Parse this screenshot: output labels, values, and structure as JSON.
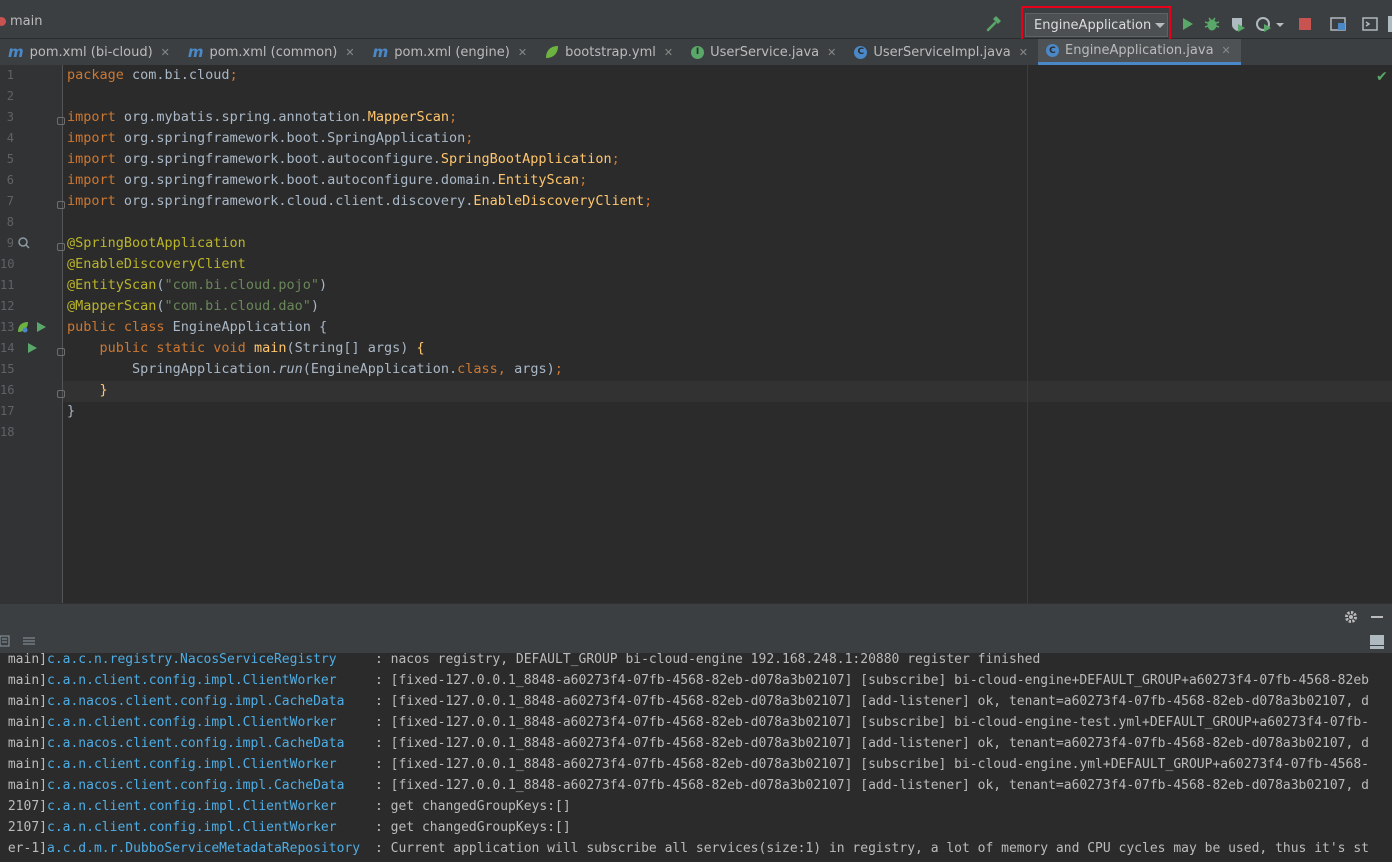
{
  "toolbar": {
    "branch": "main",
    "run_config": "EngineApplication"
  },
  "tabs": [
    {
      "label": "pom.xml (bi-cloud)",
      "icon": "maven-icon",
      "active": false
    },
    {
      "label": "pom.xml (common)",
      "icon": "maven-icon",
      "active": false
    },
    {
      "label": "pom.xml (engine)",
      "icon": "maven-icon",
      "active": false
    },
    {
      "label": "bootstrap.yml",
      "icon": "spring-leaf-icon",
      "active": false
    },
    {
      "label": "UserService.java",
      "icon": "interface-icon",
      "active": false
    },
    {
      "label": "UserServiceImpl.java",
      "icon": "class-icon",
      "active": false
    },
    {
      "label": "EngineApplication.java",
      "icon": "spring-class-icon",
      "active": true
    }
  ],
  "editor": {
    "line_numbers": [
      "1",
      "2",
      "3",
      "4",
      "5",
      "6",
      "7",
      "8",
      "9",
      "10",
      "11",
      "12",
      "13",
      "14",
      "15",
      "16",
      "17",
      "18"
    ],
    "lines": [
      [
        [
          "kw",
          "package "
        ],
        [
          "pl",
          "com.bi.cloud"
        ],
        [
          "kw",
          ";"
        ]
      ],
      [],
      [
        [
          "kw",
          "import "
        ],
        [
          "pl",
          "org.mybatis.spring.annotation."
        ],
        [
          "fn",
          "MapperScan"
        ],
        [
          "kw",
          ";"
        ]
      ],
      [
        [
          "kw",
          "import "
        ],
        [
          "pl",
          "org.springframework.boot.SpringApplication"
        ],
        [
          "kw",
          ";"
        ]
      ],
      [
        [
          "kw",
          "import "
        ],
        [
          "pl",
          "org.springframework.boot.autoconfigure."
        ],
        [
          "fn",
          "SpringBootApplication"
        ],
        [
          "kw",
          ";"
        ]
      ],
      [
        [
          "kw",
          "import "
        ],
        [
          "pl",
          "org.springframework.boot.autoconfigure.domain."
        ],
        [
          "fn",
          "EntityScan"
        ],
        [
          "kw",
          ";"
        ]
      ],
      [
        [
          "kw",
          "import "
        ],
        [
          "pl",
          "org.springframework.cloud.client.discovery."
        ],
        [
          "fn",
          "EnableDiscoveryClient"
        ],
        [
          "kw",
          ";"
        ]
      ],
      [],
      [
        [
          "ann",
          "@SpringBootApplication"
        ]
      ],
      [
        [
          "ann",
          "@EnableDiscoveryClient"
        ]
      ],
      [
        [
          "ann",
          "@EntityScan"
        ],
        [
          "pl",
          "("
        ],
        [
          "str",
          "\"com.bi.cloud.pojo\""
        ],
        [
          "pl",
          ")"
        ]
      ],
      [
        [
          "ann",
          "@MapperScan"
        ],
        [
          "pl",
          "("
        ],
        [
          "str",
          "\"com.bi.cloud.dao\""
        ],
        [
          "pl",
          ")"
        ]
      ],
      [
        [
          "kw",
          "public class "
        ],
        [
          "pl",
          "EngineApplication {"
        ]
      ],
      [
        [
          "pl",
          "    "
        ],
        [
          "kw",
          "public static void "
        ],
        [
          "fn",
          "main"
        ],
        [
          "pl",
          "(String[] args) "
        ],
        [
          "fn",
          "{"
        ]
      ],
      [
        [
          "pl",
          "        SpringApplication."
        ],
        [
          "it",
          "run"
        ],
        [
          "pl",
          "(EngineApplication."
        ],
        [
          "kw",
          "class"
        ],
        [
          "kw",
          ", "
        ],
        [
          "pl",
          "args)"
        ],
        [
          "kw",
          ";"
        ]
      ],
      [
        [
          "pl",
          "    "
        ],
        [
          "fn",
          "}"
        ]
      ],
      [
        [
          "pl",
          "}"
        ]
      ],
      []
    ]
  },
  "console": {
    "lines": [
      {
        "thread": "main]",
        "logger": "c.a.c.n.registry.NacosServiceRegistry",
        "message": ": nacos registry, DEFAULT_GROUP bi-cloud-engine 192.168.248.1:20880 register finished"
      },
      {
        "thread": "main]",
        "logger": "c.a.n.client.config.impl.ClientWorker",
        "message": ": [fixed-127.0.0.1_8848-a60273f4-07fb-4568-82eb-d078a3b02107] [subscribe] bi-cloud-engine+DEFAULT_GROUP+a60273f4-07fb-4568-82eb"
      },
      {
        "thread": "main]",
        "logger": "c.a.nacos.client.config.impl.CacheData",
        "message": ": [fixed-127.0.0.1_8848-a60273f4-07fb-4568-82eb-d078a3b02107] [add-listener] ok, tenant=a60273f4-07fb-4568-82eb-d078a3b02107, d"
      },
      {
        "thread": "main]",
        "logger": "c.a.n.client.config.impl.ClientWorker",
        "message": ": [fixed-127.0.0.1_8848-a60273f4-07fb-4568-82eb-d078a3b02107] [subscribe] bi-cloud-engine-test.yml+DEFAULT_GROUP+a60273f4-07fb-"
      },
      {
        "thread": "main]",
        "logger": "c.a.nacos.client.config.impl.CacheData",
        "message": ": [fixed-127.0.0.1_8848-a60273f4-07fb-4568-82eb-d078a3b02107] [add-listener] ok, tenant=a60273f4-07fb-4568-82eb-d078a3b02107, d"
      },
      {
        "thread": "main]",
        "logger": "c.a.n.client.config.impl.ClientWorker",
        "message": ": [fixed-127.0.0.1_8848-a60273f4-07fb-4568-82eb-d078a3b02107] [subscribe] bi-cloud-engine.yml+DEFAULT_GROUP+a60273f4-07fb-4568-"
      },
      {
        "thread": "main]",
        "logger": "c.a.nacos.client.config.impl.CacheData",
        "message": ": [fixed-127.0.0.1_8848-a60273f4-07fb-4568-82eb-d078a3b02107] [add-listener] ok, tenant=a60273f4-07fb-4568-82eb-d078a3b02107, d"
      },
      {
        "thread": "2107]",
        "logger": "c.a.n.client.config.impl.ClientWorker",
        "message": ": get changedGroupKeys:[]"
      },
      {
        "thread": "2107]",
        "logger": "c.a.n.client.config.impl.ClientWorker",
        "message": ": get changedGroupKeys:[]"
      },
      {
        "thread": "er-1]",
        "logger": "a.c.d.m.r.DubboServiceMetadataRepository",
        "message": ": Current application will subscribe all services(size:1) in registry, a lot of memory and CPU cycles may be used, thus it's st"
      }
    ]
  },
  "colors": {
    "accent": "#4a88c7",
    "highlight_border": "#e8001b",
    "run_green": "#59a869",
    "stop_red": "#c75450"
  }
}
